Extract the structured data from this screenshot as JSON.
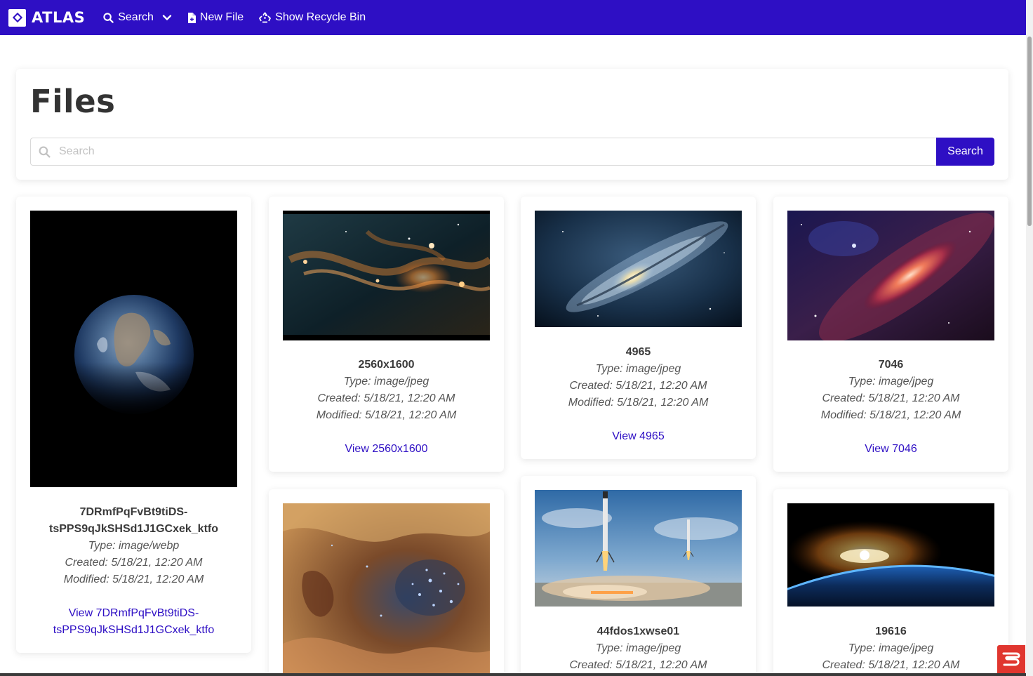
{
  "app": {
    "brand": "ATLAS"
  },
  "nav": {
    "search_label": "Search",
    "new_file_label": "New File",
    "recycle_label": "Show Recycle Bin"
  },
  "header": {
    "title": "Files",
    "search_placeholder": "Search",
    "search_value": "",
    "search_button": "Search"
  },
  "files": [
    {
      "name_line1": "7DRmfPqFvBt9tiDS-",
      "name_line2": "tsPPS9qJkSHSd1J1GCxek_ktfo",
      "type": "Type: image/webp",
      "created": "Created: 5/18/21, 12:20 AM",
      "modified": "Modified: 5/18/21, 12:20 AM",
      "link_line1": "View 7DRmfPqFvBt9tiDS-",
      "link_line2": "tsPPS9qJkSHSd1J1GCxek_ktfo",
      "image": "earth-icon"
    },
    {
      "name": "2560x1600",
      "type": "Type: image/jpeg",
      "created": "Created: 5/18/21, 12:20 AM",
      "modified": "Modified: 5/18/21, 12:20 AM",
      "link": "View 2560x1600",
      "image": "nebula-image"
    },
    {
      "name": "4965",
      "type": "Type: image/jpeg",
      "created": "Created: 5/18/21, 12:20 AM",
      "modified": "Modified: 5/18/21, 12:20 AM",
      "link": "View 4965",
      "image": "galaxy-image"
    },
    {
      "name": "7046",
      "type": "Type: image/jpeg",
      "created": "Created: 5/18/21, 12:20 AM",
      "modified": "Modified: 5/18/21, 12:20 AM",
      "link": "View 7046",
      "image": "space-image"
    },
    {
      "name": "",
      "image": "star-cluster-image"
    },
    {
      "name": "44fdos1xwse01",
      "type": "Type: image/jpeg",
      "created": "Created: 5/18/21, 12:20 AM",
      "image": "rocket-landing-image"
    },
    {
      "name": "19616",
      "type": "Type: image/jpeg",
      "created": "Created: 5/18/21, 12:20 AM",
      "image": "earth-horizon-image"
    }
  ],
  "colors": {
    "primary": "#2e0fc4",
    "badge": "#e0362f"
  }
}
